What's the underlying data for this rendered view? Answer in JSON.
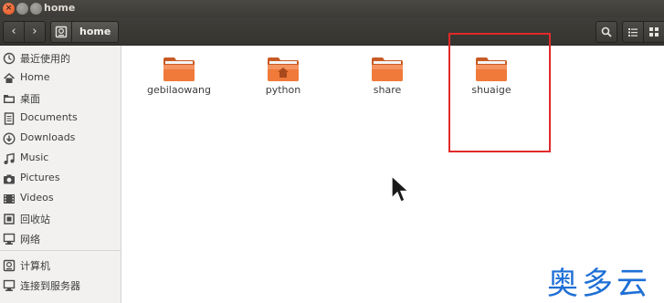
{
  "window": {
    "title": "home"
  },
  "toolbar": {
    "breadcrumb": "home"
  },
  "sidebar": {
    "items": [
      {
        "label": "最近使用的",
        "icon": "clock-icon"
      },
      {
        "label": "Home",
        "icon": "home-icon"
      },
      {
        "label": "桌面",
        "icon": "folder-icon"
      },
      {
        "label": "Documents",
        "icon": "document-icon"
      },
      {
        "label": "Downloads",
        "icon": "download-icon"
      },
      {
        "label": "Music",
        "icon": "music-icon"
      },
      {
        "label": "Pictures",
        "icon": "camera-icon"
      },
      {
        "label": "Videos",
        "icon": "video-icon"
      },
      {
        "label": "回收站",
        "icon": "trash-icon"
      },
      {
        "label": "网络",
        "icon": "network-icon"
      },
      {
        "label": "计算机",
        "icon": "drive-icon"
      },
      {
        "label": "连接到服务器",
        "icon": "server-icon"
      }
    ]
  },
  "main": {
    "folders": [
      {
        "name": "gebilaowang",
        "type": "folder"
      },
      {
        "name": "python",
        "type": "home-folder"
      },
      {
        "name": "share",
        "type": "folder"
      },
      {
        "name": "shuaige",
        "type": "folder"
      }
    ]
  },
  "watermark": {
    "text": "奥多云"
  },
  "colors": {
    "folder_orange": "#f07a3a",
    "highlight_red": "#e02a2a",
    "watermark_blue": "#1e6fd6"
  }
}
